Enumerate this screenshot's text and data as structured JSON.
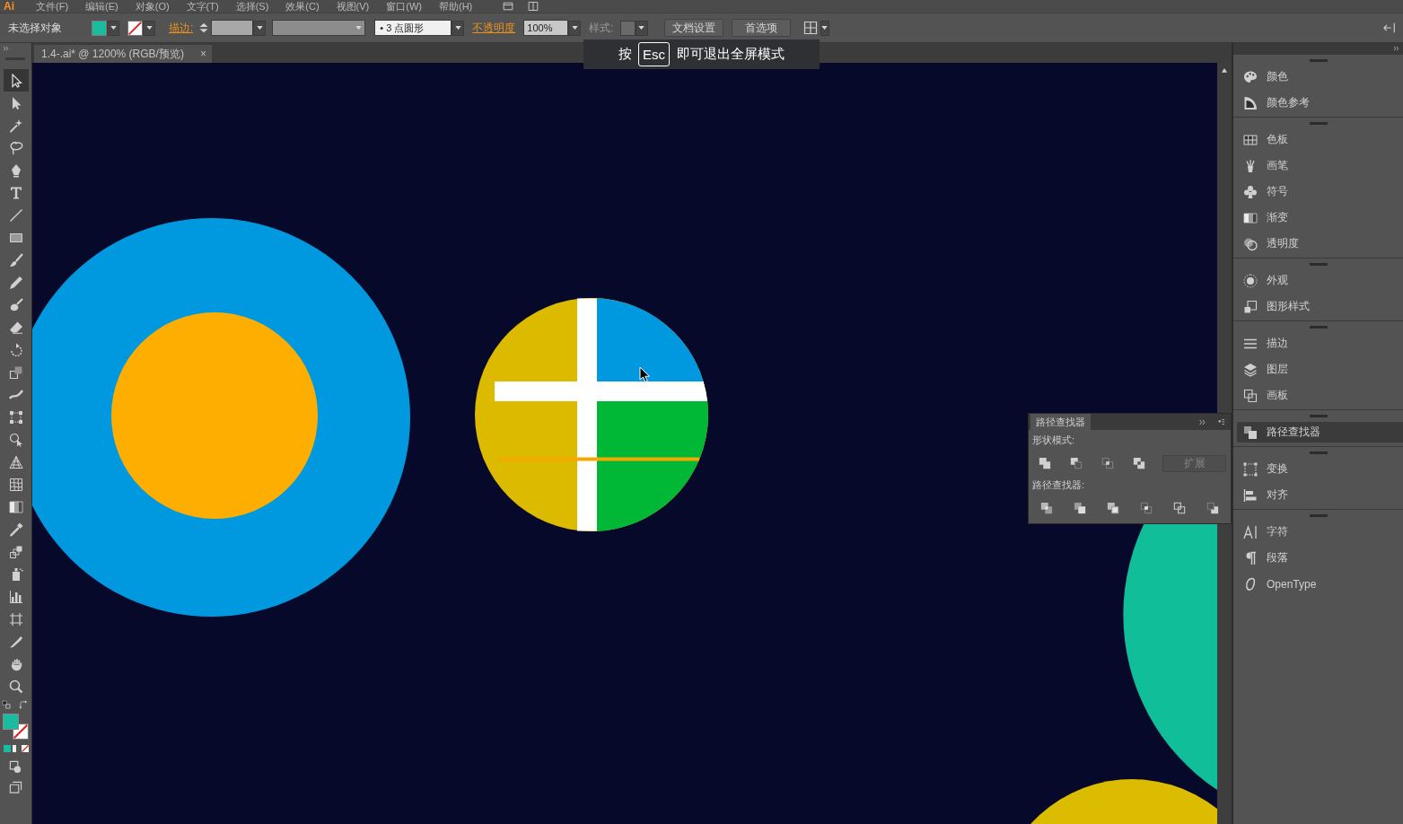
{
  "app_logo": "Ai",
  "menu_bar": [
    "文件(F)",
    "编辑(E)",
    "对象(O)",
    "文字(T)",
    "选择(S)",
    "效果(C)",
    "视图(V)",
    "窗口(W)",
    "帮助(H)"
  ],
  "control_bar": {
    "selection_label": "未选择对象",
    "fill": {
      "color": "#19bc9c"
    },
    "stroke": {
      "kind": "none"
    },
    "stroke_label": "描边:",
    "brush": "• 3 点圆形",
    "opacity_label": "不透明度",
    "opacity": "100%",
    "style_label": "样式:",
    "buttons": [
      "文档设置",
      "首选项"
    ]
  },
  "document_tab": {
    "title": "1.4-.ai* @ 1200% (RGB/预览)",
    "close": "×"
  },
  "fullscreen_notice": {
    "before": "按",
    "key": "Esc",
    "after": "即可退出全屏模式"
  },
  "toolbar": {
    "tools": [
      {
        "kind": "selection",
        "selected": true
      },
      {
        "kind": "direct_selection",
        "selected": false
      },
      {
        "kind": "magic_wand",
        "selected": false
      },
      {
        "kind": "lasso",
        "selected": false
      },
      {
        "kind": "pen",
        "selected": false
      },
      {
        "kind": "type",
        "selected": false
      },
      {
        "kind": "line",
        "selected": false
      },
      {
        "kind": "rectangle",
        "selected": false
      },
      {
        "kind": "paintbrush",
        "selected": false
      },
      {
        "kind": "pencil",
        "selected": false
      },
      {
        "kind": "blob_brush",
        "selected": false
      },
      {
        "kind": "eraser",
        "selected": false
      },
      {
        "kind": "rotate",
        "selected": false
      },
      {
        "kind": "scale",
        "selected": false
      },
      {
        "kind": "width",
        "selected": false
      },
      {
        "kind": "free_transform",
        "selected": false
      },
      {
        "kind": "shape_builder",
        "selected": false
      },
      {
        "kind": "perspective_grid",
        "selected": false
      },
      {
        "kind": "mesh",
        "selected": false
      },
      {
        "kind": "gradient",
        "selected": false
      },
      {
        "kind": "eyedropper",
        "selected": false
      },
      {
        "kind": "blend",
        "selected": false
      },
      {
        "kind": "symbol_sprayer",
        "selected": false
      },
      {
        "kind": "column_graph",
        "selected": false
      },
      {
        "kind": "artboard",
        "selected": false
      },
      {
        "kind": "slice",
        "selected": false
      },
      {
        "kind": "hand",
        "selected": false
      },
      {
        "kind": "zoom",
        "selected": false
      }
    ],
    "fill": {
      "color": "#19bc9c"
    },
    "stroke": {
      "kind": "none"
    }
  },
  "panel_dock": {
    "groups": [
      {
        "items": [
          {
            "kind": "color",
            "label": "颜色",
            "selected": false
          },
          {
            "kind": "color_guide",
            "label": "颜色参考",
            "selected": false
          }
        ]
      },
      {
        "items": [
          {
            "kind": "swatches",
            "label": "色板",
            "selected": false
          },
          {
            "kind": "brushes",
            "label": "画笔",
            "selected": false
          },
          {
            "kind": "symbols",
            "label": "符号",
            "selected": false
          },
          {
            "kind": "gradient_panel",
            "label": "渐变",
            "selected": false
          },
          {
            "kind": "transparency",
            "label": "透明度",
            "selected": false
          }
        ]
      },
      {
        "items": [
          {
            "kind": "appearance",
            "label": "外观",
            "selected": false
          },
          {
            "kind": "graphic_styles",
            "label": "图形样式",
            "selected": false
          }
        ]
      },
      {
        "items": [
          {
            "kind": "stroke",
            "label": "描边",
            "selected": false
          },
          {
            "kind": "layers",
            "label": "图层",
            "selected": false
          },
          {
            "kind": "artboards",
            "label": "画板",
            "selected": false
          }
        ]
      },
      {
        "items": [
          {
            "kind": "pathfinder",
            "label": "路径查找器",
            "selected": true
          }
        ]
      },
      {
        "items": [
          {
            "kind": "transform",
            "label": "变换",
            "selected": false
          },
          {
            "kind": "align",
            "label": "对齐",
            "selected": false
          }
        ]
      },
      {
        "items": [
          {
            "kind": "character",
            "label": "字符",
            "selected": false
          },
          {
            "kind": "paragraph",
            "label": "段落",
            "selected": false
          },
          {
            "kind": "opentype",
            "label": "OpenType",
            "selected": false
          }
        ]
      }
    ]
  },
  "pathfinder_panel": {
    "title": "路径查找器",
    "shape_modes_label": "形状模式:",
    "shape_modes": [
      {
        "kind": "unite"
      },
      {
        "kind": "minus_front"
      },
      {
        "kind": "intersect"
      },
      {
        "kind": "exclude"
      }
    ],
    "expand_button": {
      "label": "扩展",
      "disabled": true
    },
    "pathfinders_label": "路径查找器:",
    "pathfinders": [
      {
        "kind": "divide"
      },
      {
        "kind": "trim"
      },
      {
        "kind": "merge"
      },
      {
        "kind": "crop"
      },
      {
        "kind": "outline"
      },
      {
        "kind": "minus_back"
      }
    ]
  }
}
